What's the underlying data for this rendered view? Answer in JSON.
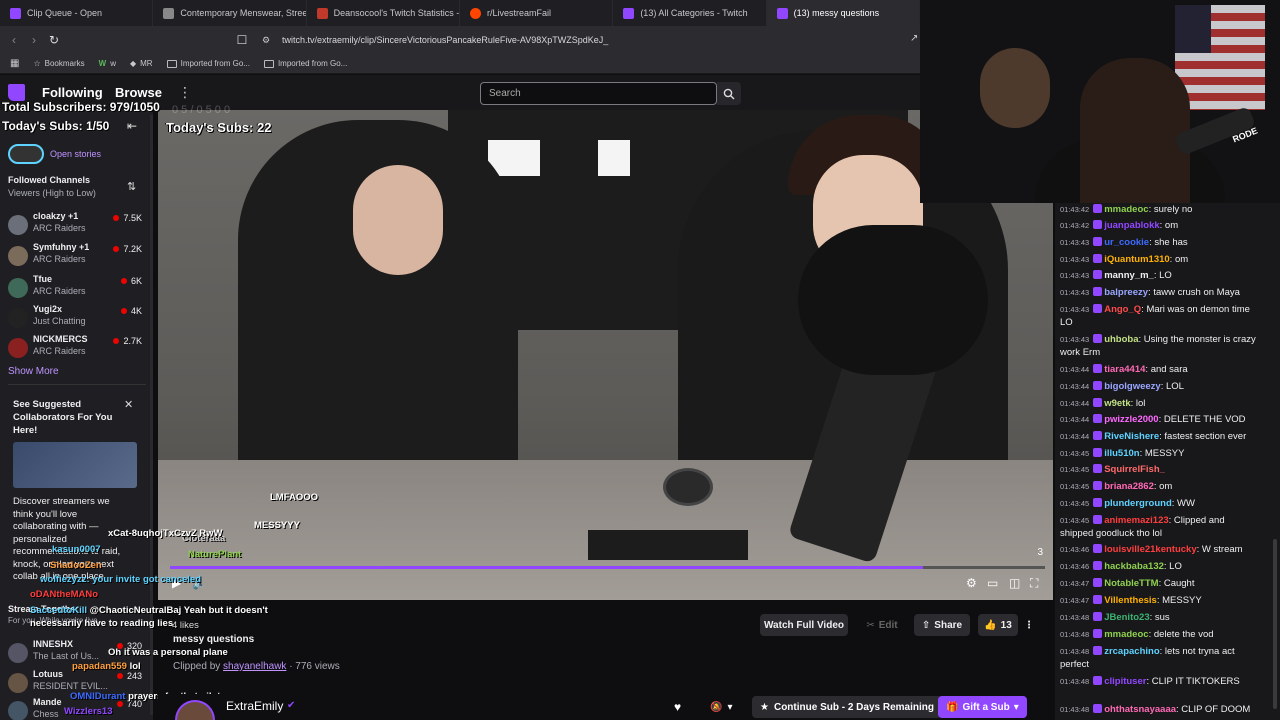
{
  "browser": {
    "tabs": [
      {
        "label": "Clip Queue - Open",
        "color": "#9147ff"
      },
      {
        "label": "Contemporary Menswear, Streetwear",
        "color": "#888888"
      },
      {
        "label": "Deansocool's Twitch Statistics - Social",
        "color": "#c0392b"
      },
      {
        "label": "r/LivestreamFail",
        "color": "#ff4500"
      },
      {
        "label": "(13) All Categories - Twitch",
        "color": "#9147ff"
      },
      {
        "label": "(13) messy questions",
        "color": "#9147ff"
      }
    ],
    "url": "twitch.tv/extraemily/clip/SincereVictoriousPancakeRuleFive-AV98XpTWZSpdKeJ_",
    "bookmarks": [
      "Bookmarks",
      "w",
      "MR",
      "Imported from Go...",
      "Imported from Go..."
    ]
  },
  "topnav": {
    "following": "Following",
    "browse": "Browse",
    "kebab": "⋮",
    "search_placeholder": "Search"
  },
  "overlay": {
    "total_subs": "Total Subscribers: 979/1050",
    "todays_subs_left": "Today's Subs: 1/50",
    "todays_subs_video": "Today's Subs: 22",
    "faded_top": "0 5 / 0 5 0 0"
  },
  "sidebar": {
    "stories": "Open stories",
    "followed_title": "Followed Channels",
    "sort_label": "Viewers (High to Low)",
    "channels": [
      {
        "name": "cloakzy +1",
        "game": "ARC Raiders",
        "viewers": "7.5K"
      },
      {
        "name": "Symfuhny +1",
        "game": "ARC Raiders",
        "viewers": "7.2K"
      },
      {
        "name": "Tfue",
        "game": "ARC Raiders",
        "viewers": "6K"
      },
      {
        "name": "Yugi2x",
        "game": "Just Chatting",
        "viewers": "4K"
      },
      {
        "name": "NICKMERCS",
        "game": "ARC Raiders",
        "viewers": "2.7K"
      }
    ],
    "show_more": "Show More",
    "card_title": "See Suggested Collaborators For You Here!",
    "card_body": "Discover streamers we think you'll love collaborating with — personalized recommendations to raid, knock, or plan your next collab all in one place.",
    "more_channels": [
      {
        "name": "INNESHX",
        "game": "The Last of Us...",
        "viewers": "320"
      },
      {
        "name": "Lotuus",
        "game": "RESIDENT EVIL...",
        "viewers": "243"
      },
      {
        "name": "Mande",
        "game": "Chess",
        "viewers": "740"
      }
    ],
    "section_label": "Stream Together",
    "for_you": "For you. While you're live..."
  },
  "overlay_chat": [
    {
      "user": "kasun0007",
      "text": ""
    },
    {
      "user": "ShadooZen",
      "text": ""
    },
    {
      "user": "wolfiezyzz",
      "text": "your invite got canceled"
    },
    {
      "user": "oDANtheMANo",
      "text": ""
    },
    {
      "user": "SaccedtoKill",
      "text": "@ChaoticNeutralBaj Yeah but it doesn't necessarily have to reading lies"
    },
    {
      "user": "papadan559",
      "text": "lol"
    },
    {
      "user": "OMNIDurant",
      "text": "prayers for that pilot"
    },
    {
      "user": "Wizzlers13",
      "text": ""
    }
  ],
  "overlay_chat_extra": {
    "line1": "xCat-8uqhojTxCzvZ RwW",
    "line2": "Oh it was a personal plane",
    "line3": "LMFAOOO",
    "line4": "MESSYYY",
    "line5": "Cloteraaa",
    "line6": "NaturePlant",
    "line7": "4 likes"
  },
  "video": {
    "progress_pct": 0.86,
    "counter": "3"
  },
  "below": {
    "title": "messy questions",
    "clipped_by_label": "Clipped by",
    "clipper": "shayanelhawk",
    "views": "· 776 views",
    "watch_full": "Watch Full Video",
    "edit": "Edit",
    "share": "Share",
    "likes": "13",
    "more": "⋮",
    "streamer": "ExtraEmily",
    "continue_sub": "Continue Sub - 2 Days Remaining",
    "gift_sub": "Gift a Sub"
  },
  "webcam": {
    "mic_brand": "RODE"
  },
  "chat": [
    {
      "ts": "01:43:42",
      "user": "mmadeoc",
      "color": "#8fd14f",
      "text": "surely no"
    },
    {
      "ts": "01:43:42",
      "user": "juanpablokk",
      "color": "#9147ff",
      "text": "om"
    },
    {
      "ts": "01:43:43",
      "user": "ur_cookie",
      "color": "#3c6bff",
      "text": "she has"
    },
    {
      "ts": "01:43:43",
      "user": "iQuantum1310",
      "color": "#ffb000",
      "text": "om"
    },
    {
      "ts": "01:43:43",
      "user": "manny_m_",
      "color": "#efeff1",
      "text": "LO"
    },
    {
      "ts": "01:43:43",
      "user": "balpreezy",
      "color": "#9aa7ff",
      "text": "taww crush on Maya"
    },
    {
      "ts": "01:43:43",
      "user": "Ango_Q",
      "color": "#ff4a4a",
      "text": "Mari was on demon time LO"
    },
    {
      "ts": "01:43:43",
      "user": "uhboba",
      "color": "#c2e085",
      "text": "Using the monster is crazy work Erm"
    },
    {
      "ts": "01:43:44",
      "user": "tiara4414",
      "color": "#ff69b4",
      "text": "and sara"
    },
    {
      "ts": "01:43:44",
      "user": "bigolgweezy",
      "color": "#9aa7ff",
      "text": "LOL"
    },
    {
      "ts": "01:43:44",
      "user": "w9etk",
      "color": "#c2e085",
      "text": "lol"
    },
    {
      "ts": "01:43:44",
      "user": "pwizzle2000",
      "color": "#ff69ff",
      "text": "DELETE THE VOD"
    },
    {
      "ts": "01:43:44",
      "user": "RiveNishere",
      "color": "#5fd3ff",
      "text": "fastest section ever"
    },
    {
      "ts": "01:43:45",
      "user": "illu510n",
      "color": "#5fd3ff",
      "text": "MESSYY"
    },
    {
      "ts": "01:43:45",
      "user": "SquirrelFish_",
      "color": "#ff6a6a",
      "text": ""
    },
    {
      "ts": "01:43:45",
      "user": "briana2862",
      "color": "#ff69b4",
      "text": "om"
    },
    {
      "ts": "01:43:45",
      "user": "plunderground",
      "color": "#5fd3ff",
      "text": "WW"
    },
    {
      "ts": "01:43:45",
      "user": "animemazi123",
      "color": "#ff3e3e",
      "text": "Clipped and shipped goodluck tho lol"
    },
    {
      "ts": "01:43:46",
      "user": "louisville21kentucky",
      "color": "#ff3e3e",
      "text": "W stream"
    },
    {
      "ts": "01:43:46",
      "user": "hackbaba132",
      "color": "#8fd14f",
      "text": "LO"
    },
    {
      "ts": "01:43:47",
      "user": "NotableTTM",
      "color": "#8fd14f",
      "text": "Caught"
    },
    {
      "ts": "01:43:47",
      "user": "Villenthesis",
      "color": "#ffb000",
      "text": "MESSYY"
    },
    {
      "ts": "01:43:48",
      "user": "JBenito23",
      "color": "#3cb371",
      "text": "sus"
    },
    {
      "ts": "01:43:48",
      "user": "mmadeoc",
      "color": "#8fd14f",
      "text": "delete the vod"
    },
    {
      "ts": "01:43:48",
      "user": "zrcapachino",
      "color": "#5fd3ff",
      "text": "lets not tryna act perfect"
    },
    {
      "ts": "01:43:48",
      "user": "clipituser",
      "color": "#9147ff",
      "text": "CLIP IT TIKTOKERS"
    },
    {
      "ts": "01:43:48",
      "user": "ohthatsnayaaaa",
      "color": "#ff69b4",
      "text": "CLIP OF DOOM"
    }
  ]
}
